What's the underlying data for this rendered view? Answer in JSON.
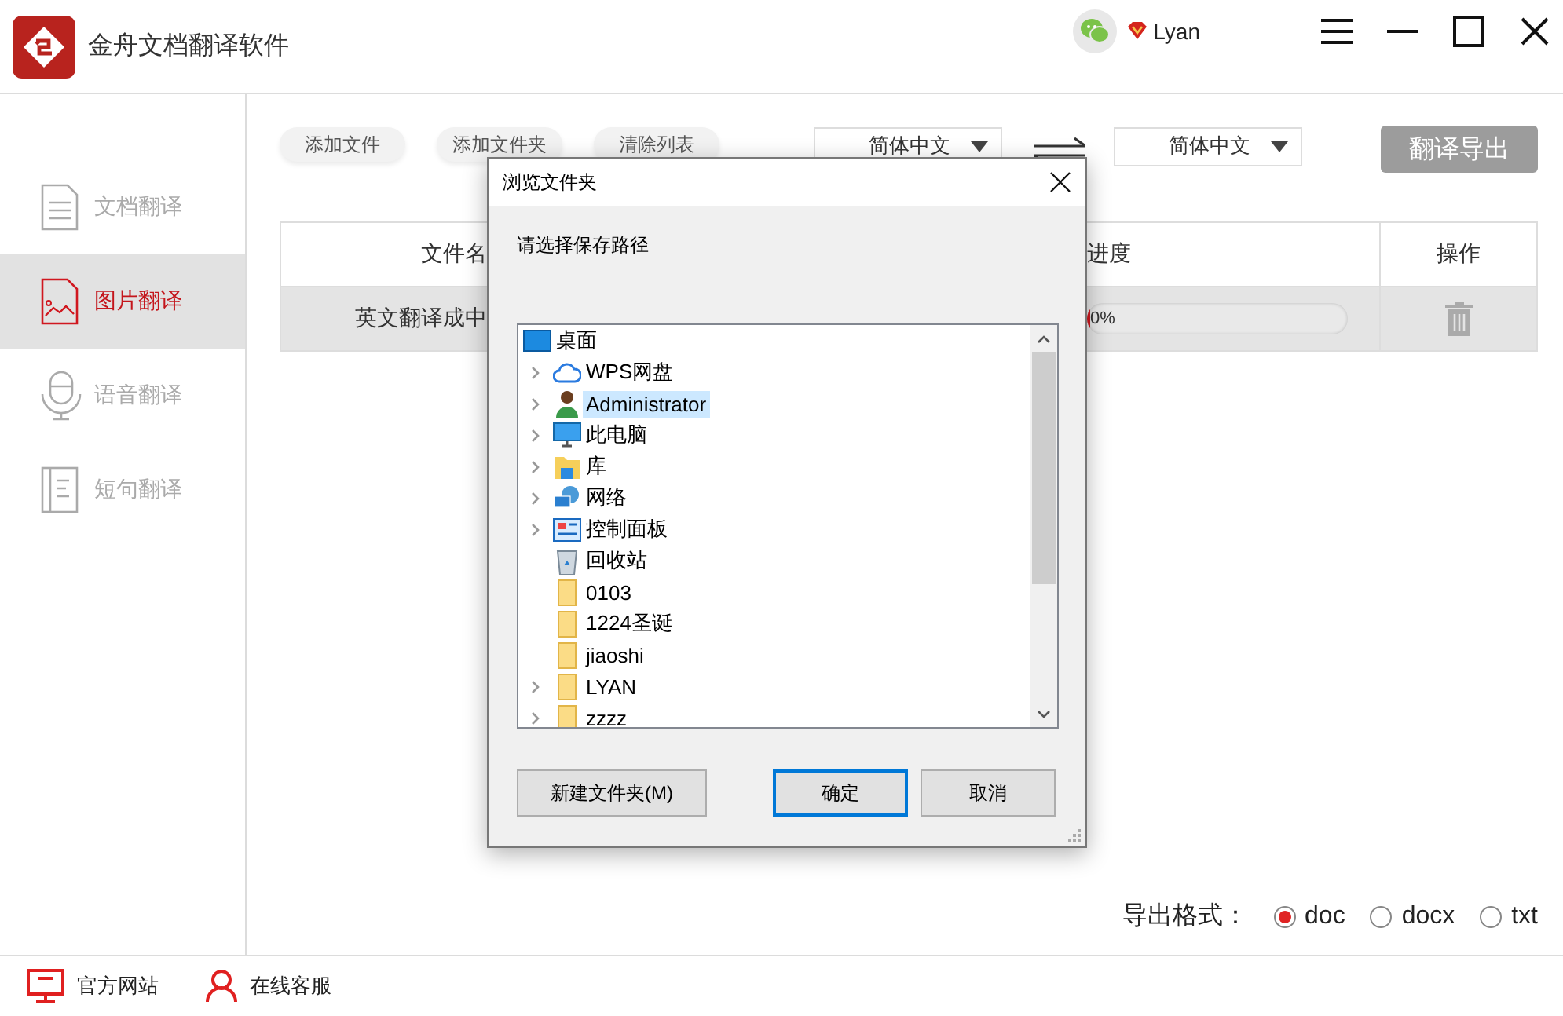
{
  "app": {
    "title": "金舟文档翻译软件"
  },
  "account": {
    "username": "Lyan"
  },
  "sidebar": {
    "items": [
      {
        "label": "文档翻译",
        "kind": "document",
        "selected": false
      },
      {
        "label": "图片翻译",
        "kind": "image",
        "selected": true
      },
      {
        "label": "语音翻译",
        "kind": "microphone",
        "selected": false
      },
      {
        "label": "短句翻译",
        "kind": "text",
        "selected": false
      }
    ]
  },
  "toolbar": {
    "buttons": [
      "添加文件",
      "添加文件夹",
      "清除列表"
    ],
    "source_language": "简体中文",
    "target_language": "简体中文",
    "export_button": "翻译导出"
  },
  "table": {
    "columns": [
      "文件名",
      "进度",
      "操作"
    ],
    "rows": [
      {
        "file_name": "英文翻译成中",
        "progress": "0%",
        "level": 0
      }
    ]
  },
  "export_format": {
    "label": "导出格式：",
    "options": [
      {
        "label": "doc",
        "selected": true
      },
      {
        "label": "docx",
        "selected": false
      },
      {
        "label": "txt",
        "selected": false
      }
    ]
  },
  "footer": {
    "links": [
      {
        "label": "官方网站",
        "kind": "monitor"
      },
      {
        "label": "在线客服",
        "kind": "person"
      }
    ]
  },
  "dialog": {
    "title": "浏览文件夹",
    "prompt": "请选择保存路径",
    "tree": {
      "label": "桌面",
      "kind": "desktop",
      "children": [
        {
          "label": "WPS网盘",
          "kind": "cloud",
          "expandable": true,
          "selected": false
        },
        {
          "label": "Administrator",
          "kind": "user",
          "expandable": true,
          "selected": true
        },
        {
          "label": "此电脑",
          "kind": "computer",
          "expandable": true,
          "selected": false
        },
        {
          "label": "库",
          "kind": "library",
          "expandable": true,
          "selected": false
        },
        {
          "label": "网络",
          "kind": "network",
          "expandable": true,
          "selected": false
        },
        {
          "label": "控制面板",
          "kind": "control-panel",
          "expandable": true,
          "selected": false
        },
        {
          "label": "回收站",
          "kind": "recycle-bin",
          "expandable": false,
          "selected": false
        },
        {
          "label": "0103",
          "kind": "folder",
          "expandable": false,
          "selected": false
        },
        {
          "label": "1224圣诞",
          "kind": "folder",
          "expandable": false,
          "selected": false
        },
        {
          "label": "jiaoshi",
          "kind": "folder",
          "expandable": false,
          "selected": false
        },
        {
          "label": "LYAN",
          "kind": "folder",
          "expandable": true,
          "selected": false
        },
        {
          "label": "zzzz",
          "kind": "folder",
          "expandable": true,
          "selected": false
        }
      ]
    },
    "buttons": [
      {
        "label": "新建文件夹(M)",
        "default": false
      },
      {
        "label": "确定",
        "default": true
      },
      {
        "label": "取消",
        "default": false
      }
    ]
  }
}
